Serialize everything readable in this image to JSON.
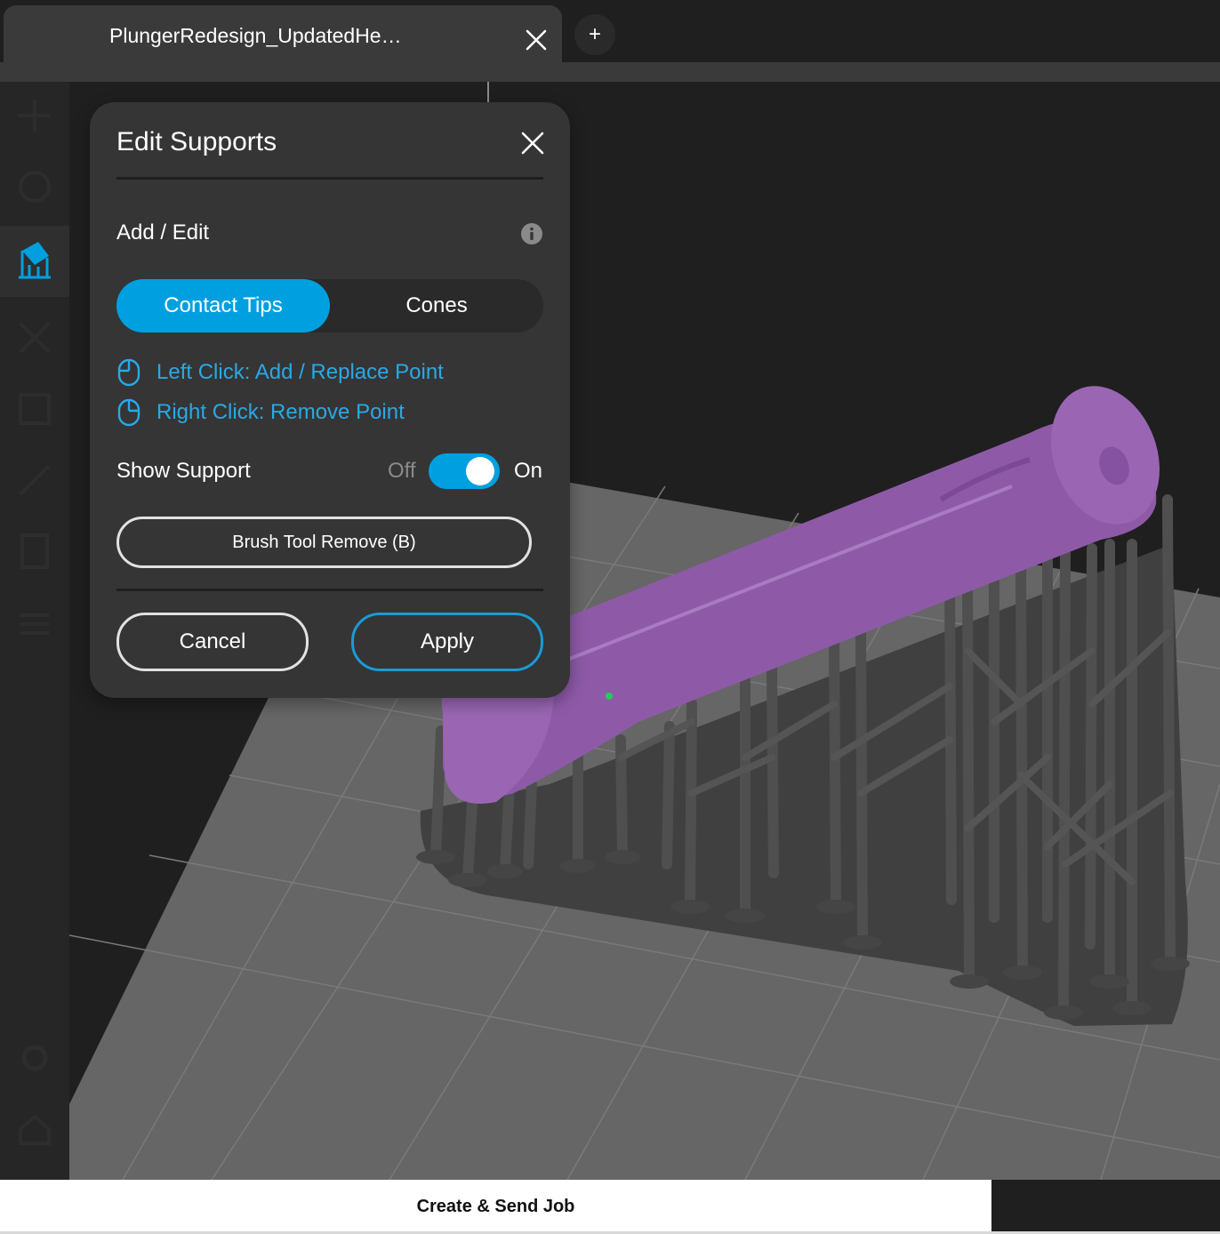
{
  "tabs": {
    "active_title": "PlungerRedesign_UpdatedHe…",
    "new_tab_glyph": "+",
    "close_icon": "close-icon"
  },
  "toolbar": {
    "icons": [
      "move-icon",
      "rotate-icon",
      "supports-icon",
      "scale-icon",
      "layout-icon",
      "measure-icon",
      "print-check-icon",
      "layers-icon",
      "settings-icon",
      "home-icon"
    ],
    "active_tool": "supports-icon",
    "accent_color": "#00a0e0"
  },
  "dialog": {
    "title": "Edit Supports",
    "section_label": "Add / Edit",
    "segments": {
      "active": "Contact Tips",
      "inactive": "Cones"
    },
    "hints": {
      "left_click": "Left Click: Add / Replace Point",
      "right_click": "Right Click: Remove Point"
    },
    "show_support": {
      "label": "Show Support",
      "off_label": "Off",
      "on_label": "On",
      "state": "on"
    },
    "brush_button": "Brush Tool Remove (B)",
    "cancel_button": "Cancel",
    "apply_button": "Apply",
    "hint_color": "#29a9e6",
    "accent_color": "#00a0e0"
  },
  "scene": {
    "model_color": "#8e5aa8",
    "support_color": "#4a4a4a",
    "build_plate_color": "#666666"
  },
  "footer": {
    "send_job_label": "Create & Send Job"
  }
}
